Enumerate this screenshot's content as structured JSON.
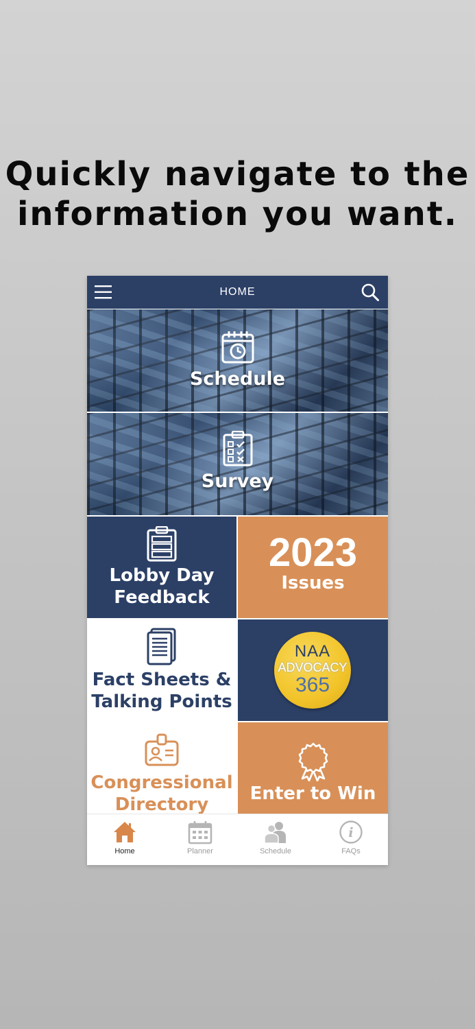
{
  "headline": {
    "line1": "Quickly navigate to the",
    "line2": "information you want."
  },
  "header": {
    "title": "HOME",
    "menu_icon": "hamburger-menu-icon",
    "search_icon": "search-icon"
  },
  "tiles": {
    "schedule": {
      "label": "Schedule",
      "icon": "calendar-clock-icon"
    },
    "survey": {
      "label": "Survey",
      "icon": "checklist-clipboard-icon"
    },
    "lobby": {
      "line1": "Lobby Day",
      "line2": "Feedback",
      "icon": "clipboard-icon"
    },
    "issues": {
      "year": "2023",
      "label": "Issues"
    },
    "fact": {
      "line1": "Fact Sheets &",
      "line2": "Talking Points",
      "icon": "document-pages-icon"
    },
    "advocacy": {
      "line1": "NAA",
      "line2": "ADVOCACY",
      "line3": "365"
    },
    "congress": {
      "line1": "Congressional",
      "line2": "Directory",
      "icon": "id-badge-icon"
    },
    "win": {
      "label": "Enter to Win",
      "icon": "award-ribbon-icon"
    }
  },
  "tabbar": {
    "items": [
      {
        "label": "Home",
        "icon": "home-icon",
        "active": true
      },
      {
        "label": "Planner",
        "icon": "calendar-grid-icon",
        "active": false
      },
      {
        "label": "Schedule",
        "icon": "people-icon",
        "active": false
      },
      {
        "label": "FAQs",
        "icon": "info-icon",
        "active": false
      }
    ]
  },
  "colors": {
    "navy": "#2c4066",
    "orange": "#d89058",
    "active_tab": "#d8864a",
    "inactive_tab": "#b5b5b5",
    "advocacy_yellow": "#f2c42a"
  }
}
